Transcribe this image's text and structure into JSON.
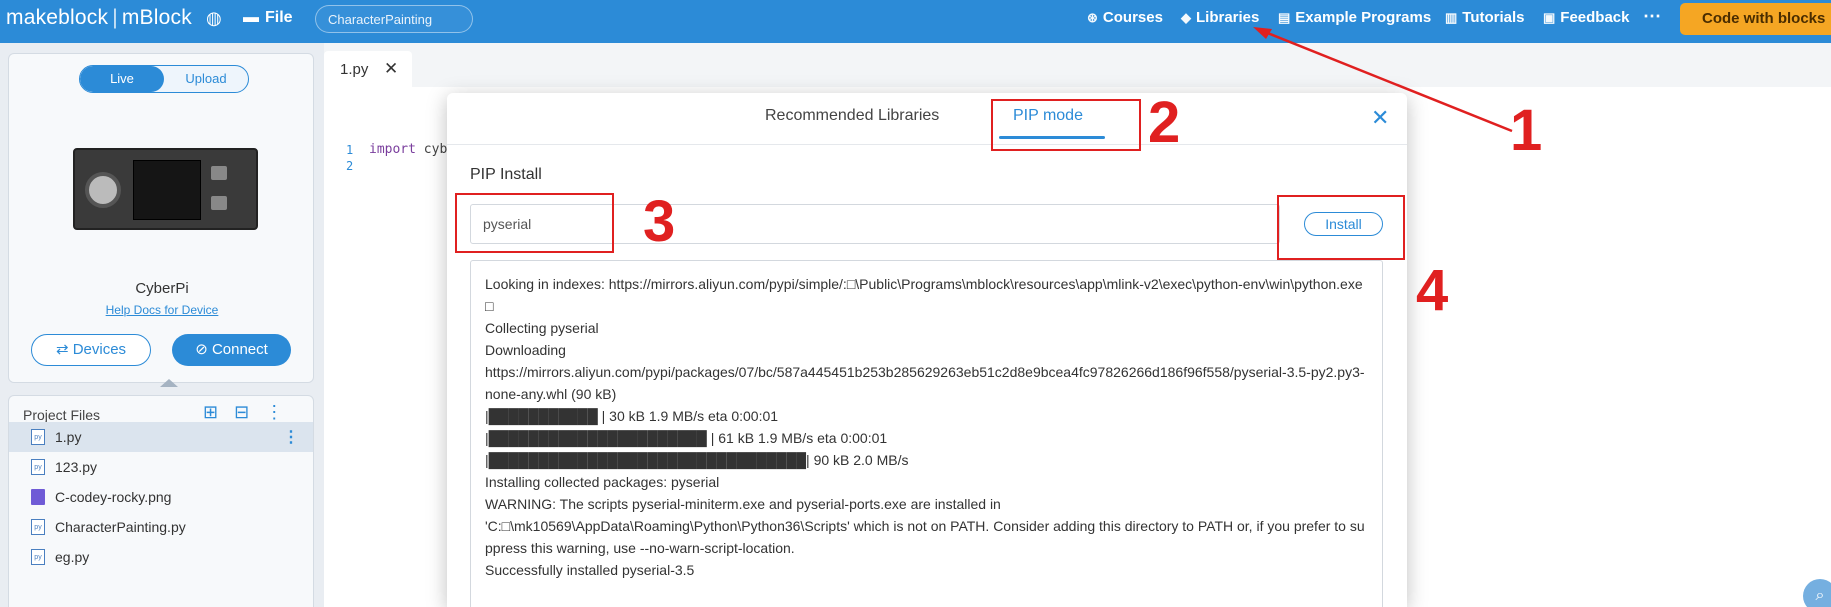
{
  "topbar": {
    "brand": "makeblock",
    "product": "mBlock",
    "file_label": "File",
    "project_name": "CharacterPainting",
    "nav": [
      {
        "label": "Courses",
        "icon": "compass-icon"
      },
      {
        "label": "Libraries",
        "icon": "cube-icon"
      },
      {
        "label": "Example Programs",
        "icon": "document-icon"
      },
      {
        "label": "Tutorials",
        "icon": "book-icon"
      },
      {
        "label": "Feedback",
        "icon": "chat-icon"
      }
    ],
    "more": "⋯",
    "code_with_blocks": "Code with blocks"
  },
  "device": {
    "mode_live": "Live",
    "mode_upload": "Upload",
    "name": "CyberPi",
    "help": "Help Docs for Device",
    "devices_btn": "Devices",
    "connect_btn": "Connect"
  },
  "files": {
    "title": "Project Files",
    "items": [
      {
        "name": "1.py",
        "type": "py"
      },
      {
        "name": "123.py",
        "type": "py"
      },
      {
        "name": "C-codey-rocky.png",
        "type": "img"
      },
      {
        "name": "CharacterPainting.py",
        "type": "py"
      },
      {
        "name": "eg.py",
        "type": "py"
      }
    ]
  },
  "editor": {
    "tab": "1.py",
    "line_numbers": [
      "1",
      "2"
    ],
    "line1_kw": "import",
    "line1_rest": " cyb"
  },
  "modal": {
    "tab_recommended": "Recommended Libraries",
    "tab_pip": "PIP mode",
    "section_title": "PIP Install",
    "input_value": "pyserial",
    "install_btn": "Install",
    "log": [
      "Looking in indexes: https://mirrors.aliyun.com/pypi/simple/:□\\Public\\Programs\\mblock\\resources\\app\\mlink-v2\\exec\\python-env\\win\\python.exe□",
      "Collecting pyserial",
      "Downloading",
      "https://mirrors.aliyun.com/pypi/packages/07/bc/587a445451b253b285629263eb51c2d8e9bcea4fc97826266d186f96f558/pyserial-3.5-py2.py3-none-any.whl (90 kB)",
      "|███████████ | 30 kB 1.9 MB/s eta 0:00:01",
      "|██████████████████████ | 61 kB 1.9 MB/s eta 0:00:01",
      "|████████████████████████████████| 90 kB 2.0 MB/s",
      "Installing collected packages: pyserial",
      "WARNING: The scripts pyserial-miniterm.exe and pyserial-ports.exe are installed in",
      "'C:□\\mk10569\\AppData\\Roaming\\Python\\Python36\\Scripts' which is not on PATH. Consider adding this directory to PATH or, if you prefer to suppress this warning, use --no-warn-script-location.",
      "Successfully installed pyserial-3.5"
    ]
  },
  "annotations": {
    "n1": "1",
    "n2": "2",
    "n3": "3",
    "n4": "4",
    "color": "#e02020"
  },
  "colors": {
    "primary": "#2c8bd7",
    "accent": "#f5a623"
  }
}
